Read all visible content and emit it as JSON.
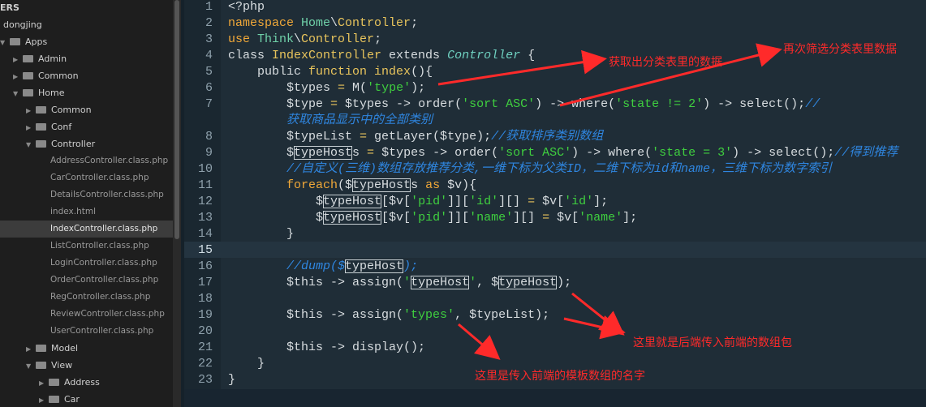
{
  "sidebar": {
    "items": [
      {
        "label": "ERS",
        "kind": "header",
        "depth": 0
      },
      {
        "label": "dongjing",
        "kind": "root",
        "depth": 0
      },
      {
        "label": "Apps",
        "kind": "folder-open",
        "depth": 0
      },
      {
        "label": "Admin",
        "kind": "folder",
        "depth": 1
      },
      {
        "label": "Common",
        "kind": "folder",
        "depth": 1
      },
      {
        "label": "Home",
        "kind": "folder-open",
        "depth": 1
      },
      {
        "label": "Common",
        "kind": "folder",
        "depth": 2
      },
      {
        "label": "Conf",
        "kind": "folder",
        "depth": 2
      },
      {
        "label": "Controller",
        "kind": "folder-open",
        "depth": 2
      },
      {
        "label": "AddressController.class.php",
        "kind": "file",
        "depth": 3
      },
      {
        "label": "CarController.class.php",
        "kind": "file",
        "depth": 3
      },
      {
        "label": "DetailsController.class.php",
        "kind": "file",
        "depth": 3
      },
      {
        "label": "index.html",
        "kind": "file",
        "depth": 3
      },
      {
        "label": "IndexController.class.php",
        "kind": "file",
        "depth": 3,
        "selected": true
      },
      {
        "label": "ListController.class.php",
        "kind": "file",
        "depth": 3
      },
      {
        "label": "LoginController.class.php",
        "kind": "file",
        "depth": 3
      },
      {
        "label": "OrderController.class.php",
        "kind": "file",
        "depth": 3
      },
      {
        "label": "RegController.class.php",
        "kind": "file",
        "depth": 3
      },
      {
        "label": "ReviewController.class.php",
        "kind": "file",
        "depth": 3
      },
      {
        "label": "UserController.class.php",
        "kind": "file",
        "depth": 3
      },
      {
        "label": "Model",
        "kind": "folder",
        "depth": 2
      },
      {
        "label": "View",
        "kind": "folder-open",
        "depth": 2
      },
      {
        "label": "Address",
        "kind": "folder",
        "depth": 3
      },
      {
        "label": "Car",
        "kind": "folder",
        "depth": 3
      }
    ]
  },
  "editor": {
    "current_line": "15",
    "lines": [
      {
        "n": "1",
        "t": [
          [
            "v",
            "<?php"
          ]
        ]
      },
      {
        "n": "2",
        "t": [
          [
            "k",
            "namespace "
          ],
          [
            "ns",
            "Home"
          ],
          [
            "v",
            "\\"
          ],
          [
            "cn",
            "Controller"
          ],
          [
            "v",
            ";"
          ]
        ]
      },
      {
        "n": "3",
        "t": [
          [
            "k",
            "use "
          ],
          [
            "ns",
            "Think"
          ],
          [
            "v",
            "\\"
          ],
          [
            "cn",
            "Controller"
          ],
          [
            "v",
            ";"
          ]
        ]
      },
      {
        "n": "4",
        "t": [
          [
            "v",
            "class "
          ],
          [
            "cn",
            "IndexController"
          ],
          [
            "v",
            " extends "
          ],
          [
            "ci",
            "Controller"
          ],
          [
            "v",
            " {"
          ]
        ]
      },
      {
        "n": "5",
        "t": [
          [
            "v",
            "    public "
          ],
          [
            "f",
            "function index"
          ],
          [
            "v",
            "(){"
          ]
        ]
      },
      {
        "n": "6",
        "t": [
          [
            "v",
            "        $types "
          ],
          [
            "op",
            "="
          ],
          [
            "v",
            " M("
          ],
          [
            "s",
            "'type'"
          ],
          [
            "v",
            ");"
          ]
        ]
      },
      {
        "n": "7",
        "t": [
          [
            "v",
            "        $type "
          ],
          [
            "op",
            "="
          ],
          [
            "v",
            " $types -> order("
          ],
          [
            "s",
            "'sort ASC'"
          ],
          [
            "v",
            ") -> where("
          ],
          [
            "s",
            "'state != 2'"
          ],
          [
            "v",
            ") -> select();"
          ],
          [
            "c",
            "//"
          ]
        ]
      },
      {
        "n": "",
        "t": [
          [
            "c",
            "        获取商品显示中的全部类别"
          ]
        ]
      },
      {
        "n": "8",
        "t": [
          [
            "v",
            "        $typeList "
          ],
          [
            "op",
            "="
          ],
          [
            "v",
            " getLayer($type);"
          ],
          [
            "c",
            "//获取排序类别数组"
          ]
        ]
      },
      {
        "n": "9",
        "t": [
          [
            "v",
            "        $"
          ],
          [
            "box",
            "typeHost"
          ],
          [
            "v",
            "s "
          ],
          [
            "op",
            "="
          ],
          [
            "v",
            " $types -> order("
          ],
          [
            "s",
            "'sort ASC'"
          ],
          [
            "v",
            ") -> where("
          ],
          [
            "s",
            "'state = 3'"
          ],
          [
            "v",
            ") -> select();"
          ],
          [
            "c",
            "//得到推荐"
          ]
        ]
      },
      {
        "n": "10",
        "t": [
          [
            "c",
            "        //自定义(三维)数组存放推荐分类,一维下标为父类ID，二维下标为id和name，三维下标为数字索引"
          ]
        ]
      },
      {
        "n": "11",
        "t": [
          [
            "k",
            "        foreach"
          ],
          [
            "v",
            "($"
          ],
          [
            "box",
            "typeHost"
          ],
          [
            "v",
            "s "
          ],
          [
            "k",
            "as"
          ],
          [
            "v",
            " $v){"
          ]
        ]
      },
      {
        "n": "12",
        "t": [
          [
            "v",
            "            $"
          ],
          [
            "box",
            "typeHost"
          ],
          [
            "v",
            "[$v["
          ],
          [
            "s",
            "'pid'"
          ],
          [
            "v",
            "]]["
          ],
          [
            "s",
            "'id'"
          ],
          [
            "v",
            "][] "
          ],
          [
            "op",
            "="
          ],
          [
            "v",
            " $v["
          ],
          [
            "s",
            "'id'"
          ],
          [
            "v",
            "];"
          ]
        ]
      },
      {
        "n": "13",
        "t": [
          [
            "v",
            "            $"
          ],
          [
            "box",
            "typeHost"
          ],
          [
            "v",
            "[$v["
          ],
          [
            "s",
            "'pid'"
          ],
          [
            "v",
            "]]["
          ],
          [
            "s",
            "'name'"
          ],
          [
            "v",
            "][] "
          ],
          [
            "op",
            "="
          ],
          [
            "v",
            " $v["
          ],
          [
            "s",
            "'name'"
          ],
          [
            "v",
            "];"
          ]
        ]
      },
      {
        "n": "14",
        "t": [
          [
            "v",
            "        }"
          ]
        ]
      },
      {
        "n": "15",
        "t": []
      },
      {
        "n": "16",
        "t": [
          [
            "c",
            "        //dump($"
          ],
          [
            "box",
            "typeHost"
          ],
          [
            "c",
            ");"
          ]
        ]
      },
      {
        "n": "17",
        "t": [
          [
            "v",
            "        $this -> assign("
          ],
          [
            "s",
            "'"
          ],
          [
            "box",
            "typeHost"
          ],
          [
            "s",
            "'"
          ],
          [
            "v",
            ", $"
          ],
          [
            "box",
            "typeHost"
          ],
          [
            "v",
            ");"
          ]
        ]
      },
      {
        "n": "18",
        "t": []
      },
      {
        "n": "19",
        "t": [
          [
            "v",
            "        $this -> assign("
          ],
          [
            "s",
            "'types'"
          ],
          [
            "v",
            ", $typeList);"
          ]
        ]
      },
      {
        "n": "20",
        "t": []
      },
      {
        "n": "21",
        "t": [
          [
            "v",
            "        $this -> display();"
          ]
        ]
      },
      {
        "n": "22",
        "t": [
          [
            "v",
            "    }"
          ]
        ]
      },
      {
        "n": "23",
        "t": [
          [
            "v",
            "}"
          ]
        ]
      }
    ]
  },
  "annotations": {
    "a1": "获取出分类表里的数据",
    "a2": "再次筛选分类表里数据",
    "a3": "这里就是后端传入前端的数组包",
    "a4": "这里是传入前端的模板数组的名字",
    "color": "#ff2a2a"
  }
}
